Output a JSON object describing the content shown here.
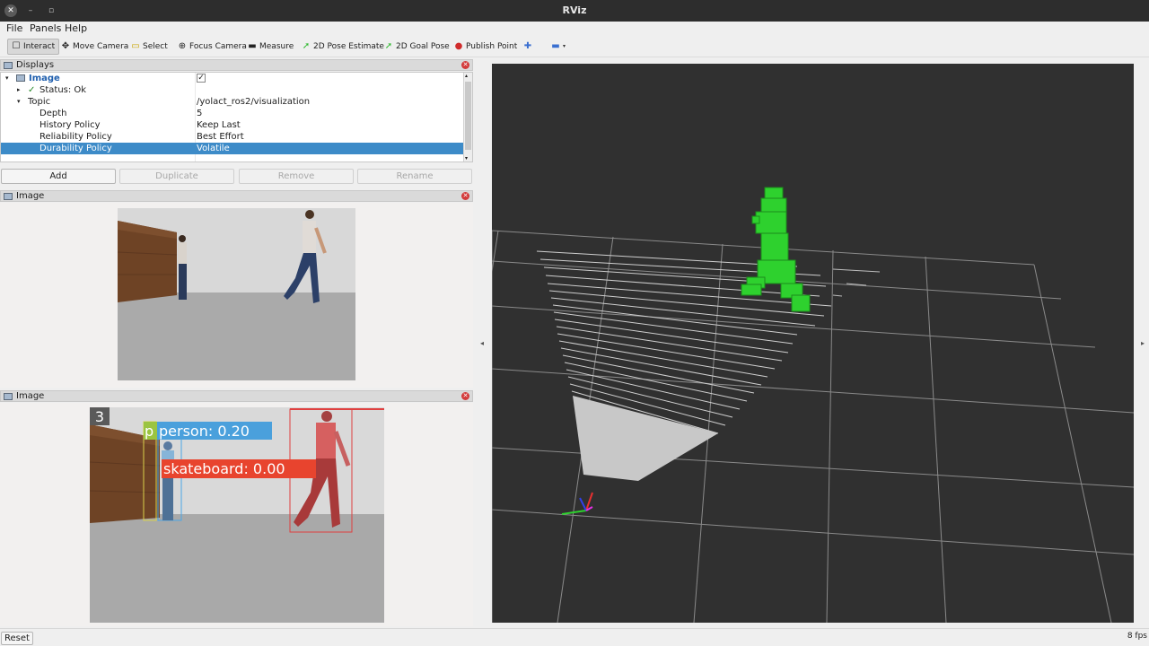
{
  "window": {
    "title": "RViz"
  },
  "menu": [
    "File",
    "Panels",
    "Help"
  ],
  "toolbar": {
    "interact": "Interact",
    "move_camera": "Move Camera",
    "select": "Select",
    "focus_camera": "Focus Camera",
    "measure": "Measure",
    "pose_estimate": "2D Pose Estimate",
    "goal_pose": "2D Goal Pose",
    "publish_point": "Publish Point"
  },
  "displays": {
    "title": "Displays",
    "rows": [
      {
        "label": "Image",
        "value": "✓"
      },
      {
        "label": "Status: Ok",
        "value": ""
      },
      {
        "label": "Topic",
        "value": "/yolact_ros2/visualization"
      },
      {
        "label": "Depth",
        "value": "5"
      },
      {
        "label": "History Policy",
        "value": "Keep Last"
      },
      {
        "label": "Reliability Policy",
        "value": "Best Effort"
      },
      {
        "label": "Durability Policy",
        "value": "Volatile"
      }
    ],
    "buttons": {
      "add": "Add",
      "duplicate": "Duplicate",
      "remove": "Remove",
      "rename": "Rename"
    }
  },
  "image_panel_1": {
    "title": "Image"
  },
  "image_panel_2": {
    "title": "Image",
    "frame_count": "3",
    "labels": {
      "p": "p",
      "person": "person: 0.20",
      "skateboard": "skateboard: 0.00"
    }
  },
  "status": {
    "reset": "Reset",
    "fps": "8 fps"
  },
  "colors": {
    "selection": "#3d8bc8",
    "voxel": "#2ed12e",
    "person_box": "#4aa8e8",
    "skateboard_box": "#e8442e",
    "close": "#d33a3a"
  }
}
